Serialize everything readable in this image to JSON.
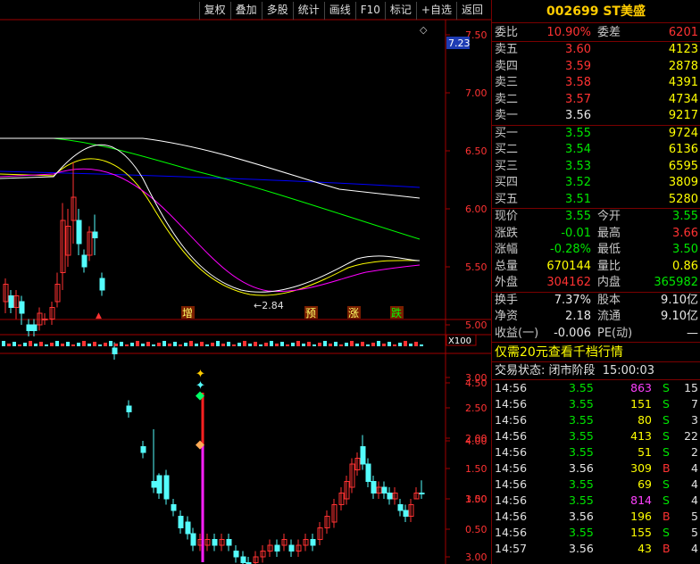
{
  "toolbar": {
    "buttons": [
      "复权",
      "叠加",
      "多股",
      "统计",
      "画线",
      "F10",
      "标记",
      "+自选",
      "返回"
    ]
  },
  "price_chart": {
    "current_price_tag": "7.23",
    "axis_ticks": [
      "7.50",
      "7.00",
      "6.50",
      "6.00",
      "5.50",
      "5.00",
      "4.50",
      "4.00",
      "3.50",
      "3.00"
    ],
    "low_annotation": "2.84",
    "signal_labels": [
      "增",
      "预",
      "涨",
      "跌"
    ],
    "volume_scale_label": "X100"
  },
  "indicator_chart": {
    "axis_ticks": [
      "3.00",
      "2.50",
      "2.00",
      "1.50",
      "1.00",
      "0.50"
    ]
  },
  "colors": {
    "up": "#ff3232",
    "down": "#00e600",
    "up_candle": "#ff3232",
    "down_candle": "#54fcfc",
    "ma1": "#ffffff",
    "ma2": "#ffff00",
    "ma3": "#ff00ff",
    "ma4": "#00ff00",
    "ma5": "#0000ff",
    "panel_border": "#7a0000",
    "title": "#ffcc00"
  },
  "quote": {
    "title": "002699 ST美盛",
    "weibi_label": "委比",
    "weibi_value": "10.90%",
    "weicha_label": "委差",
    "weicha_value": "6201",
    "asks": [
      {
        "label": "卖五",
        "price": "3.60",
        "volume": "4123"
      },
      {
        "label": "卖四",
        "price": "3.59",
        "volume": "2878"
      },
      {
        "label": "卖三",
        "price": "3.58",
        "volume": "4391"
      },
      {
        "label": "卖二",
        "price": "3.57",
        "volume": "4734"
      },
      {
        "label": "卖一",
        "price": "3.56",
        "volume": "9217"
      }
    ],
    "bids": [
      {
        "label": "买一",
        "price": "3.55",
        "volume": "9724"
      },
      {
        "label": "买二",
        "price": "3.54",
        "volume": "6136"
      },
      {
        "label": "买三",
        "price": "3.53",
        "volume": "6595"
      },
      {
        "label": "买四",
        "price": "3.52",
        "volume": "3809"
      },
      {
        "label": "买五",
        "price": "3.51",
        "volume": "5280"
      }
    ],
    "stats": [
      {
        "l1": "现价",
        "v1": "3.55",
        "c1": "green",
        "l2": "今开",
        "v2": "3.55",
        "c2": "green"
      },
      {
        "l1": "涨跌",
        "v1": "-0.01",
        "c1": "green",
        "l2": "最高",
        "v2": "3.66",
        "c2": "red"
      },
      {
        "l1": "涨幅",
        "v1": "-0.28%",
        "c1": "green",
        "l2": "最低",
        "v2": "3.50",
        "c2": "green"
      },
      {
        "l1": "总量",
        "v1": "670144",
        "c1": "yellow",
        "l2": "量比",
        "v2": "0.86",
        "c2": "yellow"
      },
      {
        "l1": "外盘",
        "v1": "304162",
        "c1": "red",
        "l2": "内盘",
        "v2": "365982",
        "c2": "green"
      }
    ],
    "fund": [
      {
        "l1": "换手",
        "v1": "7.37%",
        "l2": "股本",
        "v2": "9.10亿"
      },
      {
        "l1": "净资",
        "v1": "2.18",
        "l2": "流通",
        "v2": "9.10亿"
      },
      {
        "l1": "收益(一)",
        "v1": "-0.006",
        "l2": "PE(动)",
        "v2": "—"
      }
    ],
    "promo": "仅需20元查看千档行情",
    "status_label": "交易状态:",
    "status_value": "闭市阶段",
    "status_time": "15:00:03"
  },
  "ticks": [
    {
      "time": "14:56",
      "price": "3.55",
      "pc": "green",
      "vol": "863",
      "vc": "magenta",
      "side": "S",
      "n": "15"
    },
    {
      "time": "14:56",
      "price": "3.55",
      "pc": "green",
      "vol": "151",
      "vc": "yellow",
      "side": "S",
      "n": "7"
    },
    {
      "time": "14:56",
      "price": "3.55",
      "pc": "green",
      "vol": "80",
      "vc": "yellow",
      "side": "S",
      "n": "3"
    },
    {
      "time": "14:56",
      "price": "3.55",
      "pc": "green",
      "vol": "413",
      "vc": "yellow",
      "side": "S",
      "n": "22"
    },
    {
      "time": "14:56",
      "price": "3.55",
      "pc": "green",
      "vol": "51",
      "vc": "yellow",
      "side": "S",
      "n": "2"
    },
    {
      "time": "14:56",
      "price": "3.56",
      "pc": "white",
      "vol": "309",
      "vc": "yellow",
      "side": "B",
      "n": "4"
    },
    {
      "time": "14:56",
      "price": "3.55",
      "pc": "green",
      "vol": "69",
      "vc": "yellow",
      "side": "S",
      "n": "4"
    },
    {
      "time": "14:56",
      "price": "3.55",
      "pc": "green",
      "vol": "814",
      "vc": "magenta",
      "side": "S",
      "n": "4"
    },
    {
      "time": "14:56",
      "price": "3.56",
      "pc": "white",
      "vol": "196",
      "vc": "yellow",
      "side": "B",
      "n": "5"
    },
    {
      "time": "14:56",
      "price": "3.55",
      "pc": "green",
      "vol": "155",
      "vc": "yellow",
      "side": "S",
      "n": "5"
    },
    {
      "time": "14:57",
      "price": "3.56",
      "pc": "white",
      "vol": "43",
      "vc": "yellow",
      "side": "B",
      "n": "4"
    }
  ]
}
